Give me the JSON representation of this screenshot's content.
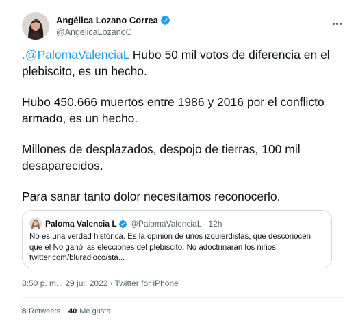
{
  "author": {
    "display_name": "Angélica Lozano Correa",
    "handle": "@AngelicaLozanoC",
    "verified_icon": "verified-badge-icon"
  },
  "tweet": {
    "mention": ".@PalomaValenciaL",
    "p1_rest": " Hubo 50 mil votos de diferencia en el plebiscito, es un hecho.",
    "p2": "Hubo 450.666 muertos entre 1986 y 2016 por el conflicto armado, es un hecho.",
    "p3": "Millones de desplazados, despojo de tierras, 100 mil desaparecidos.",
    "p4": "Para sanar tanto dolor necesitamos reconocerlo."
  },
  "quoted": {
    "display_name": "Paloma Valencia L",
    "handle": "@PalomaValenciaL",
    "separator": "·",
    "time": "12h",
    "text_line1": "No es una verdad histórica. Es la opinión de unos izquierdistas, que desconocen",
    "text_line2": "que el No ganó las elecciones del plebiscito. No adoctrinarán los niños.",
    "text_line3": "twitter.com/bluradioco/sta..."
  },
  "meta": {
    "time": "8:50 p. m.",
    "date": "29 jul. 2022",
    "separator": "·",
    "source": "Twitter for iPhone"
  },
  "stats": {
    "retweets_count": "8",
    "retweets_label": "Retweets",
    "likes_count": "40",
    "likes_label": "Me gusta"
  },
  "colors": {
    "link": "#1d9bf0",
    "secondary_text": "#536471",
    "border": "#cfd9de",
    "verified": "#1d9bf0"
  }
}
